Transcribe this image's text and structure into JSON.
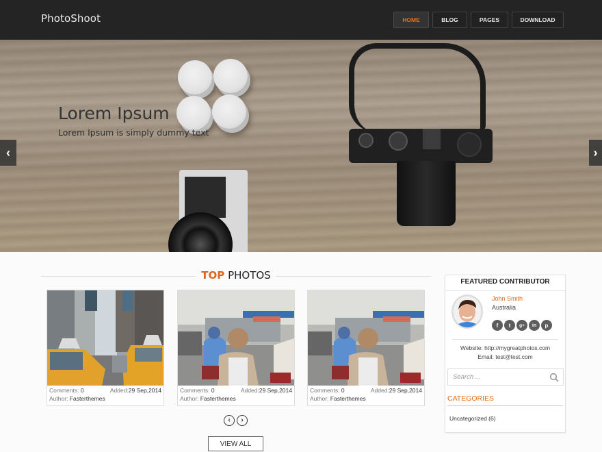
{
  "header": {
    "logo": "PhotoShoot",
    "nav": [
      {
        "label": "HOME",
        "active": true
      },
      {
        "label": "BLOG",
        "active": false
      },
      {
        "label": "PAGES",
        "active": false
      },
      {
        "label": "DOWNLOAD",
        "active": false
      }
    ]
  },
  "hero": {
    "title": "Lorem Ipsum",
    "subtitle": "Lorem Ipsum is simply dummy text",
    "prev_icon": "chevron-left-icon",
    "next_icon": "chevron-right-icon",
    "prev_glyph": "‹",
    "next_glyph": "›"
  },
  "top_photos": {
    "title_accent": "TOP",
    "title_rest": "PHOTOS",
    "items": [
      {
        "image": "city-taxis",
        "comments_label": "Comments:",
        "comments": "0",
        "added_label": "Added:",
        "added": "29 Sep,2014",
        "author_label": "Author:",
        "author": "Fasterthemes"
      },
      {
        "image": "street-scooters",
        "comments_label": "Comments:",
        "comments": "0",
        "added_label": "Added:",
        "added": "29 Sep,2014",
        "author_label": "Author:",
        "author": "Fasterthemes"
      },
      {
        "image": "street-scooters",
        "comments_label": "Comments:",
        "comments": "0",
        "added_label": "Added:",
        "added": "29 Sep,2014",
        "author_label": "Author:",
        "author": "Fasterthemes"
      }
    ],
    "pager_prev": "‹",
    "pager_next": "›",
    "view_all": "VIEW ALL"
  },
  "sidebar": {
    "featured_title": "FEATURED CONTRIBUTOR",
    "contributor_name": "John Smith",
    "contributor_country": "Australia",
    "socials": [
      {
        "name": "facebook",
        "glyph": "f"
      },
      {
        "name": "twitter",
        "glyph": "t"
      },
      {
        "name": "google-plus",
        "glyph": "g+"
      },
      {
        "name": "linkedin",
        "glyph": "in"
      },
      {
        "name": "pinterest",
        "glyph": "p"
      }
    ],
    "website": "Website: http://mygreatphotos.com",
    "email": "Email: test@test.com",
    "search_placeholder": "Search ...",
    "search_value": "",
    "categories_title": "CATEGORIES",
    "categories": [
      "Uncategorized (6)"
    ]
  },
  "colors": {
    "accent": "#e0701c",
    "header_bg": "#242424"
  }
}
